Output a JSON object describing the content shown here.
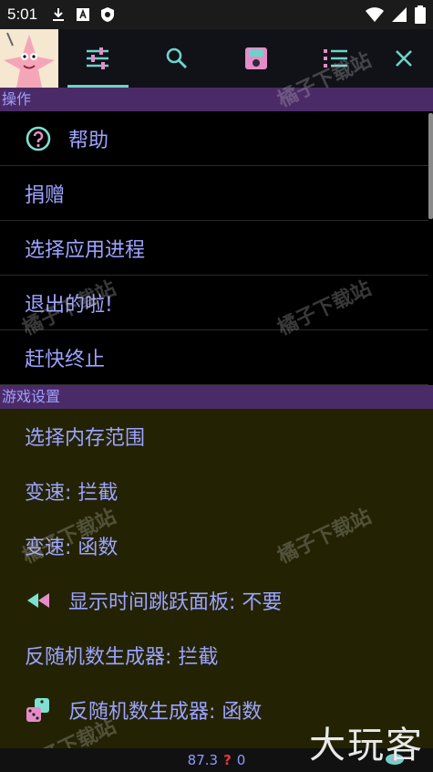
{
  "status": {
    "time": "5:01"
  },
  "sections": {
    "ops_title": "操作",
    "game_title": "游戏设置"
  },
  "ops_items": [
    {
      "label": "帮助"
    },
    {
      "label": "捐赠"
    },
    {
      "label": "选择应用进程"
    },
    {
      "label": "退出的啦!"
    },
    {
      "label": "赶快终止"
    }
  ],
  "game_items": [
    {
      "label": "选择内存范围"
    },
    {
      "label": "变速: 拦截"
    },
    {
      "label": "变速: 函数"
    },
    {
      "label": "显示时间跳跃面板: 不要"
    },
    {
      "label": "反随机数生成器: 拦截"
    },
    {
      "label": "反随机数生成器: 函数"
    }
  ],
  "bottom": {
    "value": "87.3",
    "question": "?",
    "count": "0"
  },
  "watermark": "橘子下载站",
  "brand": "大玩客",
  "colors": {
    "accent": "#6fd2c8",
    "section_bg": "#4b2b67",
    "text": "#9da3ff",
    "olive_bg": "#232304"
  }
}
